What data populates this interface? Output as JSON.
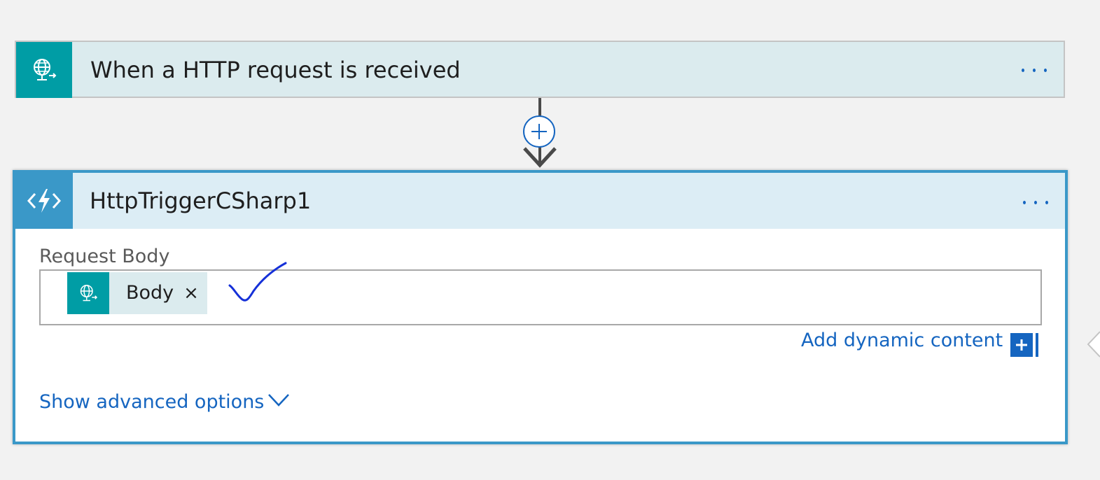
{
  "trigger": {
    "title": "When a HTTP request is received",
    "icon": "http-globe-icon",
    "accent_color": "#009da5",
    "header_color": "#dbebee"
  },
  "connector": {
    "add_icon": "plus-icon"
  },
  "action": {
    "title": "HttpTriggerCSharp1",
    "icon": "azure-function-icon",
    "accent_color": "#3a98c8",
    "header_color": "#dcedf5",
    "request_body": {
      "label": "Request Body",
      "token": {
        "label": "Body",
        "remove_glyph": "×",
        "icon": "http-globe-icon"
      },
      "annotation": "handwritten-checkmark"
    },
    "add_dynamic_content": "Add dynamic content",
    "show_advanced_options": "Show advanced options"
  },
  "colors": {
    "link": "#1565c0",
    "background": "#f2f2f2"
  }
}
